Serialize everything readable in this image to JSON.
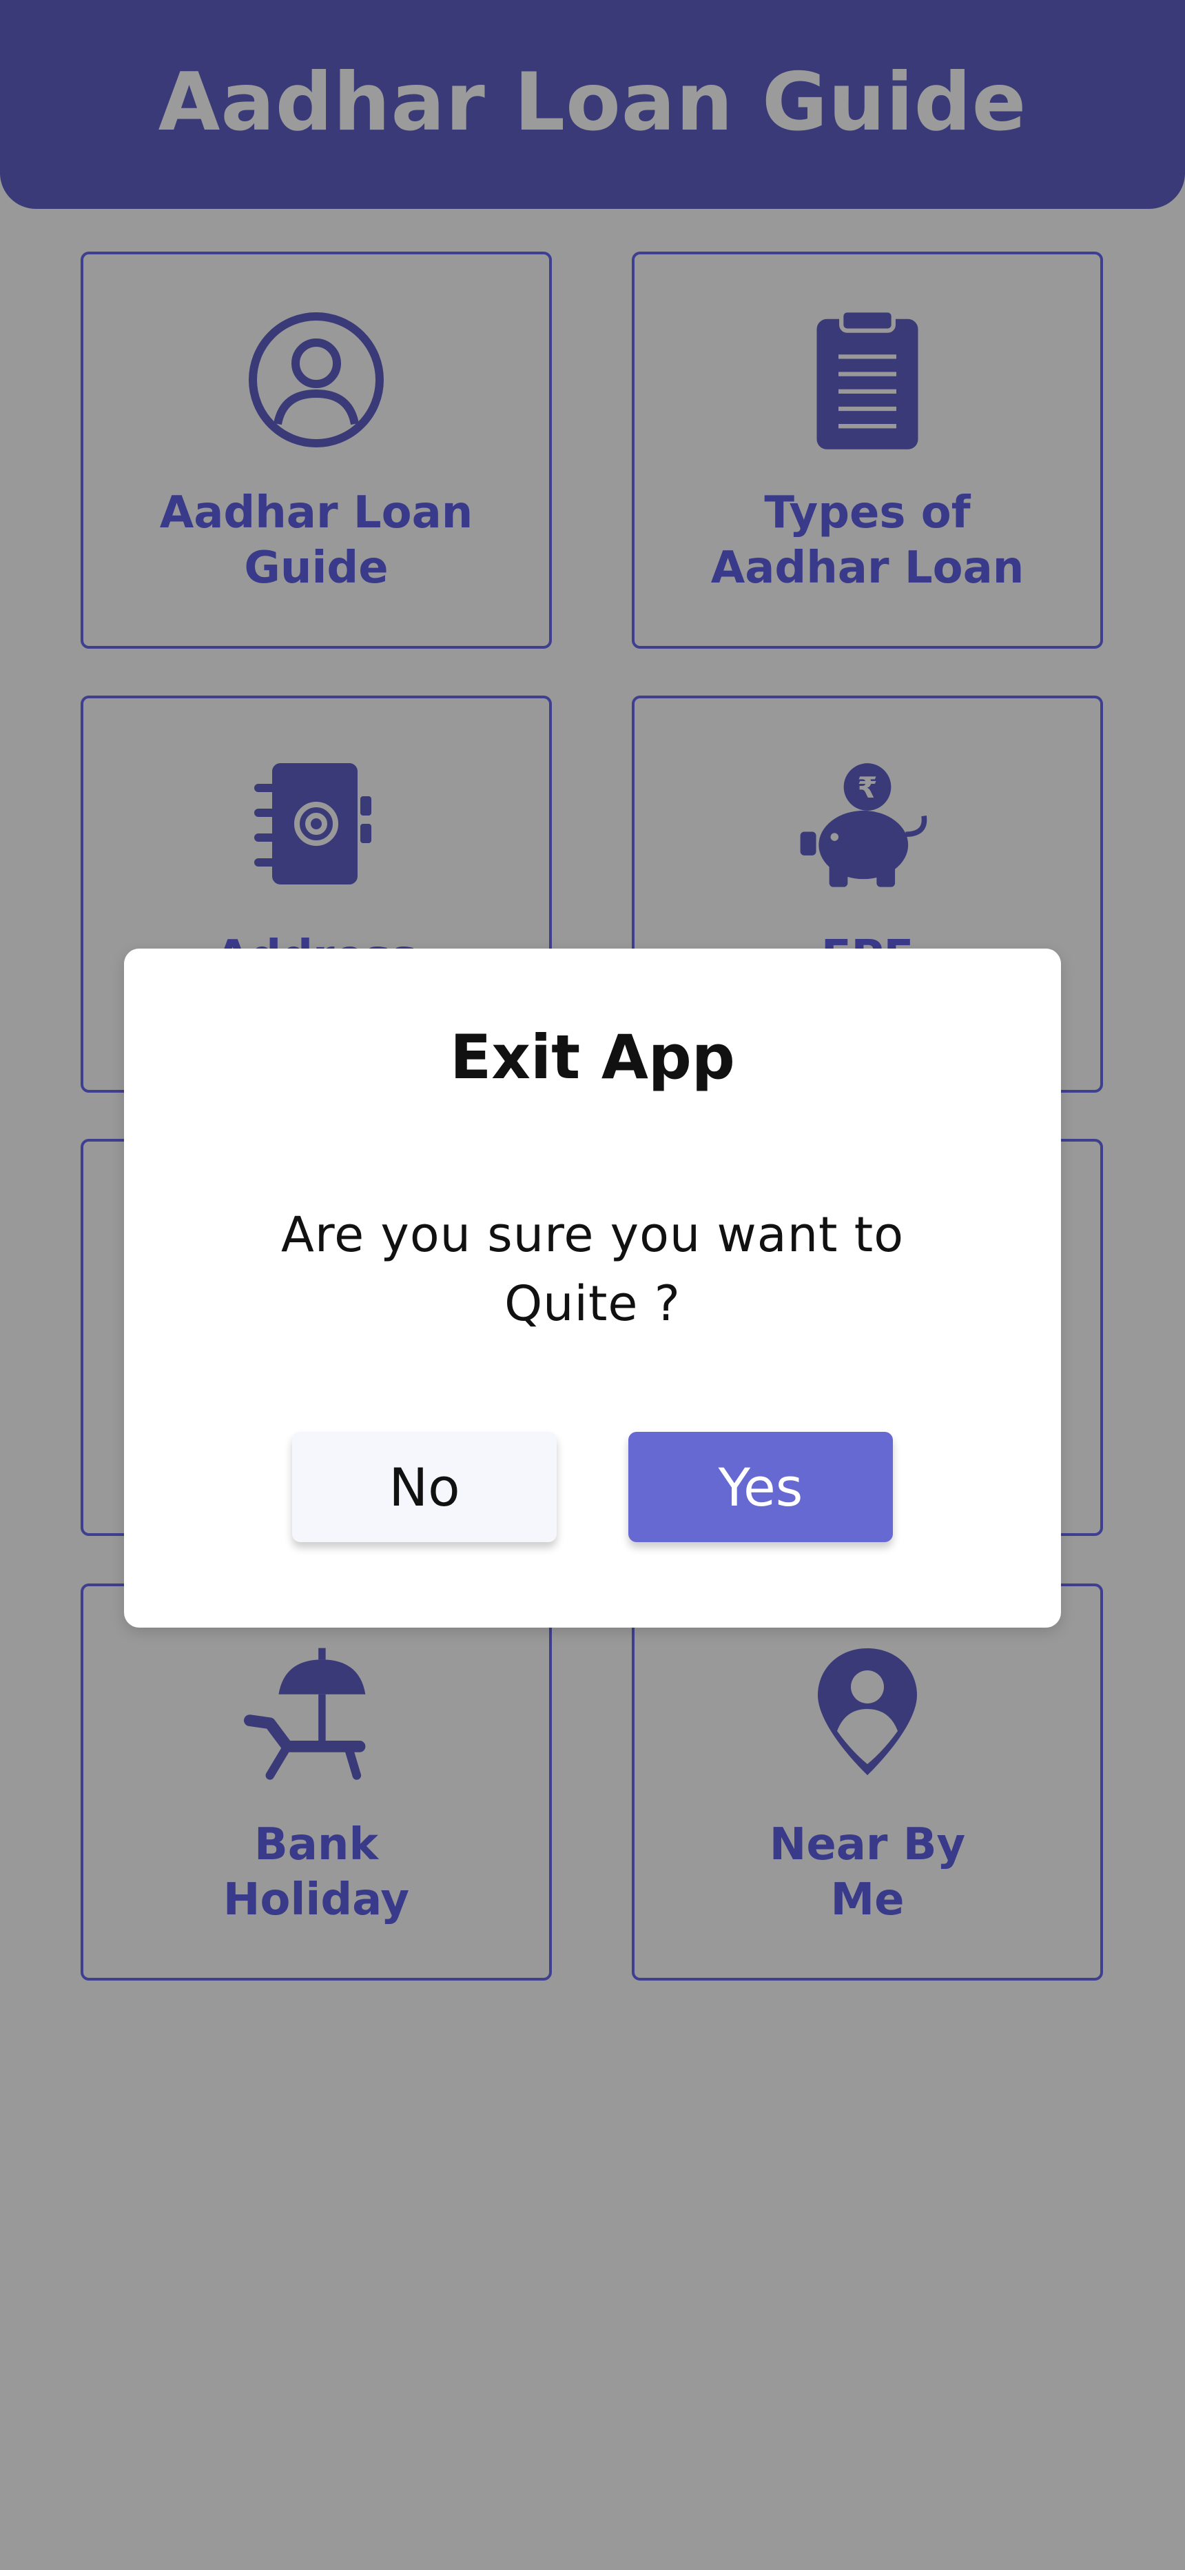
{
  "header": {
    "title": "Aadhar Loan Guide"
  },
  "cards": [
    {
      "label": "Aadhar Loan\nGuide",
      "icon": "user-circle-icon"
    },
    {
      "label": "Types of\nAadhar Loan",
      "icon": "clipboard-icon"
    },
    {
      "label": "Address",
      "icon": "address-book-icon"
    },
    {
      "label": "EPF",
      "icon": "piggy-bank-icon"
    },
    {
      "label": "Bank\nHoliday",
      "icon": "beach-chair-icon"
    },
    {
      "label": "Near By\nMe",
      "icon": "location-pin-icon"
    }
  ],
  "dialog": {
    "title": "Exit App",
    "message": "Are you sure you want to Quite ?",
    "no_label": "No",
    "yes_label": "Yes"
  },
  "colors": {
    "primary": "#3a3a78",
    "card_text": "#3a3a8a",
    "overlay": "#999999",
    "yes_button": "#6669d1"
  }
}
